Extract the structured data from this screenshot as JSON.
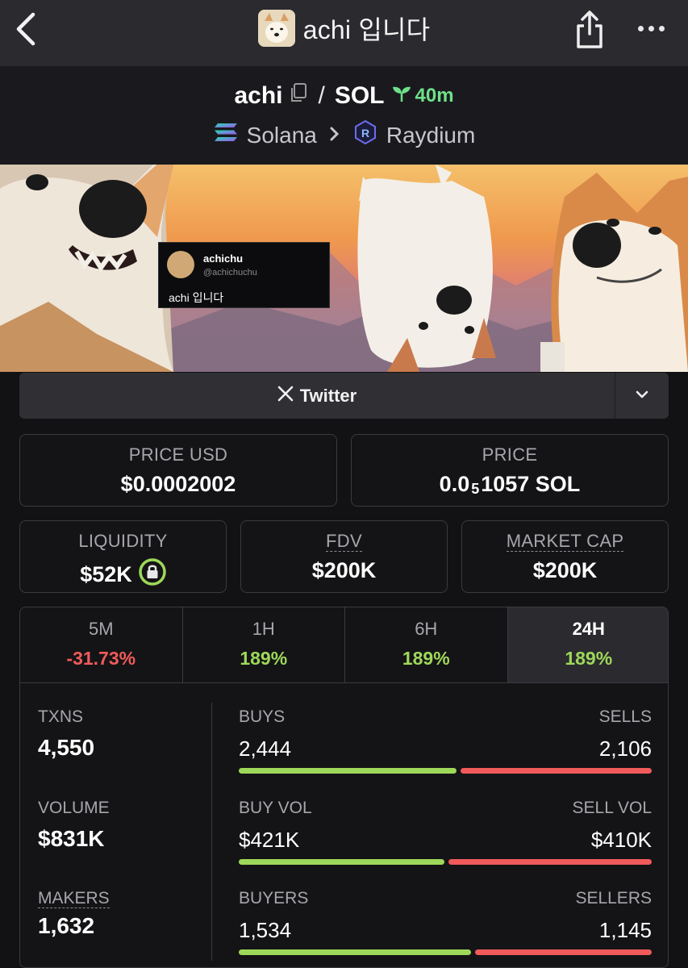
{
  "topbar": {
    "title": "achi 입니다"
  },
  "pair": {
    "base": "achi",
    "quote": "SOL",
    "separator": "/",
    "age": "40m",
    "chain": "Solana",
    "dex": "Raydium"
  },
  "banner": {
    "tweet_name": "achichu",
    "tweet_handle": "@achichuchu",
    "tweet_text": "achi 입니다"
  },
  "social": {
    "twitter_label": "Twitter"
  },
  "prices": {
    "price_usd_label": "PRICE USD",
    "price_usd": "$0.0002002",
    "price_label": "PRICE",
    "price_prefix": "0.0",
    "price_zeros": "5",
    "price_rest": "1057 SOL"
  },
  "metrics": {
    "liquidity_label": "LIQUIDITY",
    "liquidity": "$52K",
    "fdv_label": "FDV",
    "fdv": "$200K",
    "mcap_label": "MARKET CAP",
    "mcap": "$200K"
  },
  "timeframes": [
    {
      "label": "5M",
      "change": "-31.73%"
    },
    {
      "label": "1H",
      "change": "189%"
    },
    {
      "label": "6H",
      "change": "189%"
    },
    {
      "label": "24H",
      "change": "189%"
    }
  ],
  "stats": {
    "txns_label": "TXNS",
    "txns": "4,550",
    "volume_label": "VOLUME",
    "volume": "$831K",
    "makers_label": "MAKERS",
    "makers": "1,632",
    "buys_label": "BUYS",
    "buys": "2,444",
    "sells_label": "SELLS",
    "sells": "2,106",
    "buyvol_label": "BUY VOL",
    "buyvol": "$421K",
    "sellvol_label": "SELL VOL",
    "sellvol": "$410K",
    "buyers_label": "BUYERS",
    "buyers": "1,534",
    "sellers_label": "SELLERS",
    "sellers": "1,145"
  },
  "ratios": {
    "buys_share": 0.537,
    "buyvol_share": 0.507,
    "buyers_share": 0.573
  },
  "colors": {
    "positive": "#9ed85a",
    "negative": "#f05a5a",
    "age": "#6fe08a"
  }
}
